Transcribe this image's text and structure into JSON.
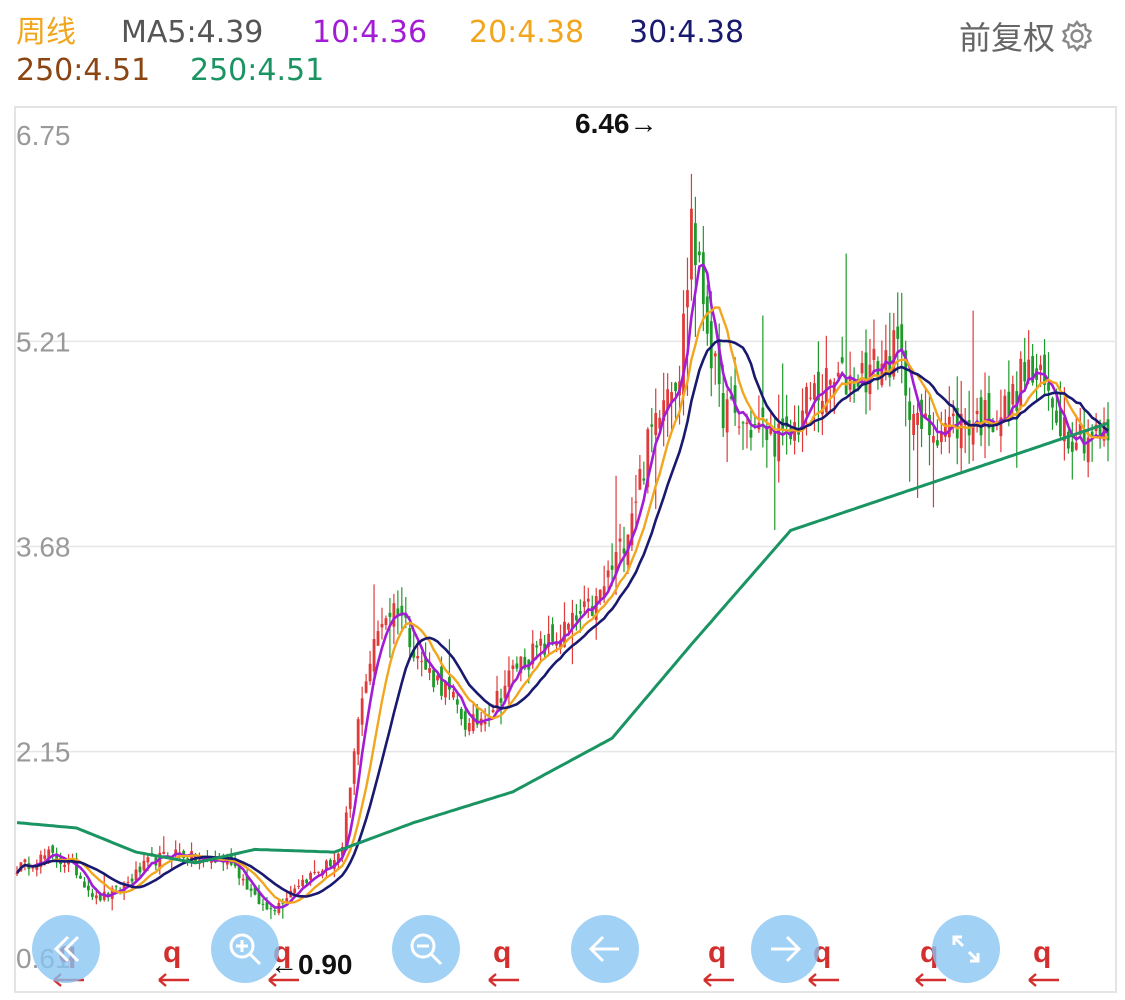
{
  "legend": {
    "period_label": "周线",
    "items": [
      {
        "label": "MA5:4.39",
        "color": "#555555"
      },
      {
        "label": "10:4.36",
        "color": "#a21cd6"
      },
      {
        "label": "20:4.38",
        "color": "#f2a61e"
      },
      {
        "label": "30:4.38",
        "color": "#191970"
      },
      {
        "label": "250:4.51",
        "color": "#8b4513"
      },
      {
        "label": "250:4.51",
        "color": "#1a9462"
      }
    ]
  },
  "adjust_label": "前复权",
  "colors": {
    "period": "#f2a61e",
    "up": "#e03a3a",
    "down": "#1e9a2a",
    "marker": "#d32f2f"
  },
  "chart_data": {
    "type": "candlestick",
    "period": "weekly",
    "y_ticks": [
      "6.75",
      "5.21",
      "3.68",
      "2.15",
      "0.61"
    ],
    "ylim": [
      0.61,
      6.75
    ],
    "grid": true,
    "max_label": "6.46→",
    "min_label": "←0.90",
    "max_value": 6.46,
    "min_value": 0.9,
    "price_path": [
      {
        "i": 0,
        "p": 1.28
      },
      {
        "i": 8,
        "p": 1.38
      },
      {
        "i": 14,
        "p": 1.3
      },
      {
        "i": 20,
        "p": 1.05
      },
      {
        "i": 26,
        "p": 1.12
      },
      {
        "i": 33,
        "p": 1.32
      },
      {
        "i": 40,
        "p": 1.4
      },
      {
        "i": 47,
        "p": 1.33
      },
      {
        "i": 54,
        "p": 1.34
      },
      {
        "i": 60,
        "p": 1.05
      },
      {
        "i": 64,
        "p": 0.95
      },
      {
        "i": 70,
        "p": 1.15
      },
      {
        "i": 78,
        "p": 1.3
      },
      {
        "i": 82,
        "p": 1.4
      },
      {
        "i": 87,
        "p": 2.6
      },
      {
        "i": 92,
        "p": 3.15
      },
      {
        "i": 96,
        "p": 3.25
      },
      {
        "i": 102,
        "p": 2.8
      },
      {
        "i": 108,
        "p": 2.62
      },
      {
        "i": 114,
        "p": 2.32
      },
      {
        "i": 120,
        "p": 2.5
      },
      {
        "i": 126,
        "p": 2.8
      },
      {
        "i": 134,
        "p": 2.95
      },
      {
        "i": 140,
        "p": 3.1
      },
      {
        "i": 146,
        "p": 3.25
      },
      {
        "i": 152,
        "p": 3.65
      },
      {
        "i": 158,
        "p": 4.3
      },
      {
        "i": 163,
        "p": 4.9
      },
      {
        "i": 167,
        "p": 5.0
      },
      {
        "i": 170,
        "p": 6.0
      },
      {
        "i": 173,
        "p": 5.55
      },
      {
        "i": 177,
        "p": 4.75
      },
      {
        "i": 182,
        "p": 4.6
      },
      {
        "i": 188,
        "p": 4.55
      },
      {
        "i": 194,
        "p": 4.45
      },
      {
        "i": 200,
        "p": 4.8
      },
      {
        "i": 206,
        "p": 4.9
      },
      {
        "i": 212,
        "p": 4.95
      },
      {
        "i": 218,
        "p": 5.05
      },
      {
        "i": 222,
        "p": 5.15
      },
      {
        "i": 227,
        "p": 4.55
      },
      {
        "i": 232,
        "p": 4.58
      },
      {
        "i": 238,
        "p": 4.6
      },
      {
        "i": 244,
        "p": 4.65
      },
      {
        "i": 250,
        "p": 4.7
      },
      {
        "i": 254,
        "p": 5.0
      },
      {
        "i": 259,
        "p": 4.85
      },
      {
        "i": 265,
        "p": 4.55
      },
      {
        "i": 270,
        "p": 4.52
      },
      {
        "i": 275,
        "p": 4.5
      }
    ],
    "ma250_path": [
      {
        "i": 0,
        "p": 1.62
      },
      {
        "i": 15,
        "p": 1.58
      },
      {
        "i": 30,
        "p": 1.4
      },
      {
        "i": 45,
        "p": 1.32
      },
      {
        "i": 60,
        "p": 1.42
      },
      {
        "i": 80,
        "p": 1.4
      },
      {
        "i": 100,
        "p": 1.62
      },
      {
        "i": 125,
        "p": 1.85
      },
      {
        "i": 150,
        "p": 2.25
      },
      {
        "i": 170,
        "p": 2.95
      },
      {
        "i": 195,
        "p": 3.8
      },
      {
        "i": 215,
        "p": 4.0
      },
      {
        "i": 235,
        "p": 4.2
      },
      {
        "i": 255,
        "p": 4.4
      },
      {
        "i": 275,
        "p": 4.6
      }
    ]
  },
  "toolbar": {
    "buttons": [
      {
        "name": "scroll-left-button",
        "icon": "double-chevron-left-icon"
      },
      {
        "name": "zoom-in-button",
        "icon": "zoom-in-icon"
      },
      {
        "name": "zoom-out-button",
        "icon": "zoom-out-icon"
      },
      {
        "name": "previous-button",
        "icon": "arrow-left-icon"
      },
      {
        "name": "next-button",
        "icon": "arrow-right-icon"
      },
      {
        "name": "fullscreen-button",
        "icon": "expand-icon"
      }
    ]
  }
}
